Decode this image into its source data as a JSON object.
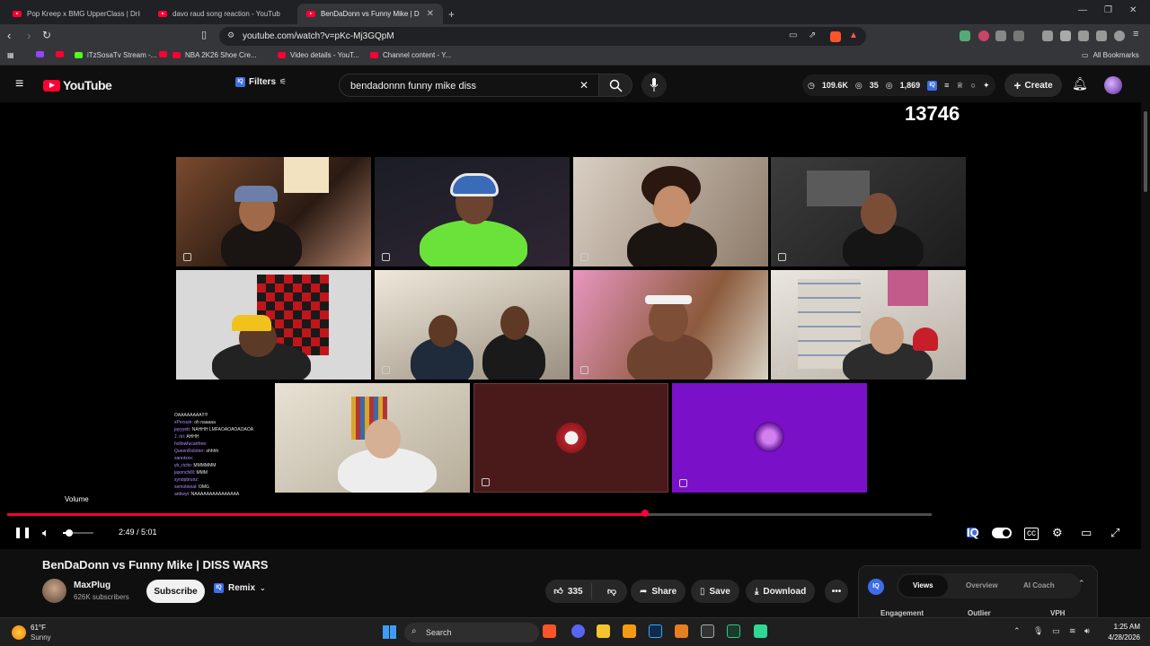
{
  "browser": {
    "tabs": [
      {
        "title": "Pop Kreep x BMG UpperClass | Drill M"
      },
      {
        "title": "davo raud song reaction - YouTub"
      },
      {
        "title": "BenDaDonn vs Funny Mike | D",
        "active": true
      }
    ],
    "new_tab": "+",
    "url": "youtube.com/watch?v=pKc-Mj3GQpM",
    "bookmarks": [
      "iTzSosaTv Stream -...",
      "NBA 2K26 Shoe Cre...",
      "Video details - YouT...",
      "Channel content - Y..."
    ],
    "all_bookmarks": "All Bookmarks"
  },
  "youtube": {
    "logo": "YouTube",
    "filters": "Filters",
    "search_query": "bendadonnn funny mike diss",
    "stats": {
      "views": "109.6K",
      "count2": "35",
      "count3": "1,869"
    },
    "create": "Create"
  },
  "video": {
    "overlay_counter": "13746",
    "chat": [
      {
        "user": "",
        "msg": "OAAAAAAAA!!!!!"
      },
      {
        "user": "xPersuin:",
        "msg": "oh naaaaa"
      },
      {
        "user": "jayyyeb:",
        "msg": "NAHHH LMFAOAOAOAOAOA"
      },
      {
        "user": "J. riri:",
        "msg": "AHHH"
      },
      {
        "user": "hollowfucanfree:",
        "msg": ""
      },
      {
        "user": "QueenRolotter:",
        "msg": "ohhhh"
      },
      {
        "user": "xanotxxx:",
        "msg": ""
      },
      {
        "user": "yb_ricito:",
        "msg": "MMMMMM"
      },
      {
        "user": "jasonchilll:",
        "msg": "MMM"
      },
      {
        "user": "synopbrunz:",
        "msg": ""
      },
      {
        "user": "xemotional:",
        "msg": "OMG"
      },
      {
        "user": "anbwyt:",
        "msg": "NAAAAAAAAAAAAAAA"
      }
    ],
    "volume_tooltip": "Volume",
    "time_current": "2:49",
    "time_sep": " / ",
    "time_total": "5:01",
    "progress": 0.69,
    "buffered": 1.0,
    "volume": 0.22
  },
  "meta": {
    "title": "BenDaDonn vs Funny Mike | DISS WARS",
    "channel": "MaxPlug",
    "subscribers": "626K subscribers",
    "subscribe": "Subscribe",
    "remix": "Remix",
    "likes": "335",
    "share": "Share",
    "save": "Save",
    "download": "Download"
  },
  "iq_panel": {
    "tabs": [
      "Views",
      "Overview",
      "AI Coach"
    ],
    "columns": [
      "Engagement",
      "Outlier",
      "VPH"
    ]
  },
  "taskbar": {
    "temp": "61°F",
    "weather": "Sunny",
    "search": "Search",
    "time": "1:25 AM",
    "date": "4/28/2026"
  },
  "colors": {
    "accent": "#ff0033",
    "iq_blue": "#3d6ee8",
    "purple_tile": "#7b10c9",
    "maroon_tile": "#4a1a1a"
  }
}
